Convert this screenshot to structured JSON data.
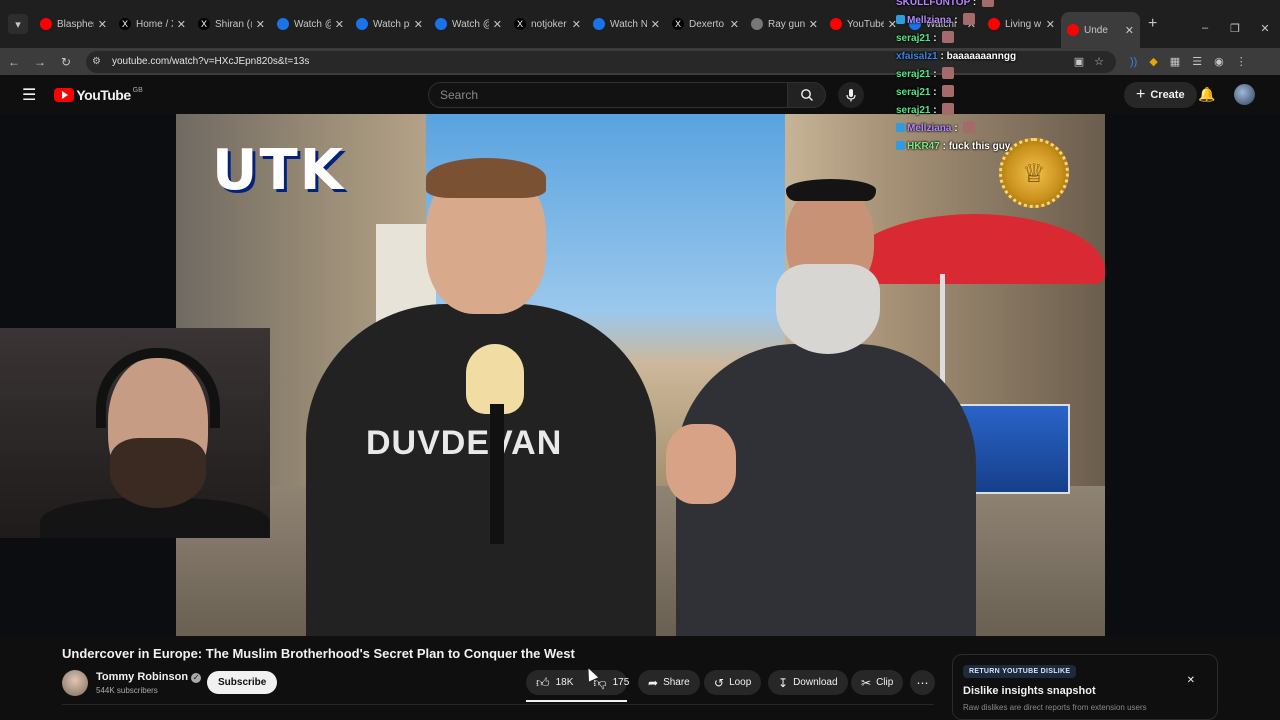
{
  "browser": {
    "tabs": [
      {
        "title": "Blasphem",
        "color": "#ff0000",
        "glyph": ""
      },
      {
        "title": "Home / X",
        "color": "#000000",
        "glyph": "X"
      },
      {
        "title": "Shiran (@",
        "color": "#000000",
        "glyph": "X"
      },
      {
        "title": "Watch @",
        "color": "#1a73e8",
        "glyph": ""
      },
      {
        "title": "Watch pl",
        "color": "#1a73e8",
        "glyph": ""
      },
      {
        "title": "Watch @",
        "color": "#1a73e8",
        "glyph": ""
      },
      {
        "title": "notjoker",
        "color": "#000000",
        "glyph": "X"
      },
      {
        "title": "Watch N",
        "color": "#1a73e8",
        "glyph": ""
      },
      {
        "title": "Dexerto",
        "color": "#000000",
        "glyph": "X"
      },
      {
        "title": "Ray gun",
        "color": "#777777",
        "glyph": ""
      },
      {
        "title": "YouTube",
        "color": "#ff0000",
        "glyph": ""
      },
      {
        "title": "Watchi",
        "color": "#1a73e8",
        "glyph": ""
      },
      {
        "title": "Living w",
        "color": "#ff0000",
        "glyph": ""
      },
      {
        "title": "Unde",
        "color": "#ff0000",
        "glyph": ""
      }
    ],
    "url": "youtube.com/watch?v=HXcJEpn820s&t=13s"
  },
  "youtube": {
    "logo_text": "YouTube",
    "country": "GB",
    "search_placeholder": "Search",
    "create_label": "Create"
  },
  "video": {
    "title": "Undercover in Europe: The Muslim Brotherhood's Secret Plan to Conquer the West",
    "overlay_brand": "UTK",
    "shirt_text": "DUVDEVAN"
  },
  "channel": {
    "name": "Tommy Robinson",
    "subscribers": "544K subscribers",
    "subscribe_label": "Subscribe"
  },
  "actions": {
    "likes": "18K",
    "dislikes": "175",
    "share": "Share",
    "loop": "Loop",
    "download": "Download",
    "clip": "Clip"
  },
  "rtyd": {
    "tag": "RETURN YOUTUBE DISLIKE",
    "heading": "Dislike insights snapshot",
    "sub": "Raw dislikes are direct reports from extension users"
  },
  "chat": [
    {
      "user": "SKULLFUNTOP",
      "color": "#b388ff",
      "badge": false,
      "msg": ""
    },
    {
      "user": "Mellziana",
      "color": "#b388ff",
      "badge": true,
      "msg": ""
    },
    {
      "user": "seraj21",
      "color": "#57e389",
      "badge": false,
      "msg": ""
    },
    {
      "user": "xfaisalz1",
      "color": "#3584e4",
      "badge": false,
      "msg": "baaaaaaanngg"
    },
    {
      "user": "seraj21",
      "color": "#57e389",
      "badge": false,
      "msg": ""
    },
    {
      "user": "seraj21",
      "color": "#57e389",
      "badge": false,
      "msg": ""
    },
    {
      "user": "seraj21",
      "color": "#57e389",
      "badge": false,
      "msg": ""
    },
    {
      "user": "Mellziana",
      "color": "#b388ff",
      "badge": true,
      "msg": ""
    },
    {
      "user": "HKR47",
      "color": "#7ee787",
      "badge": true,
      "msg": "fuck this guy"
    }
  ]
}
